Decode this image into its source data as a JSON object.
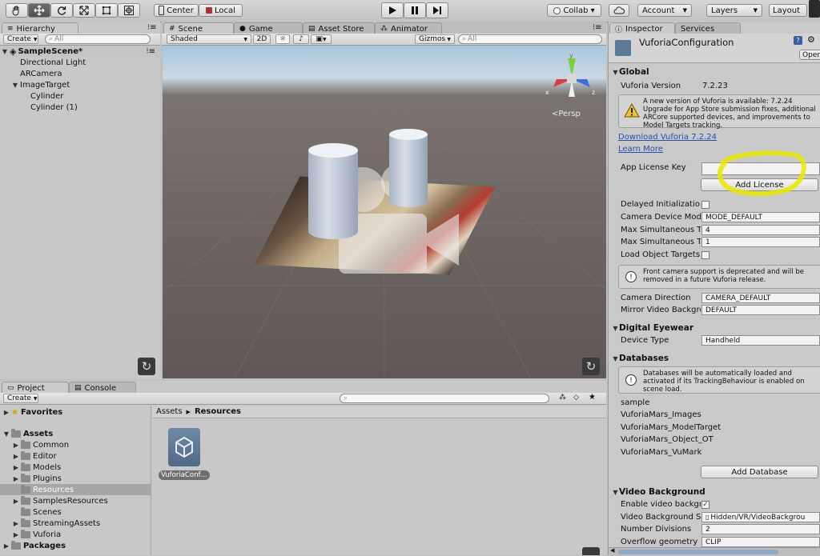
{
  "toolbar": {
    "center_label": "Center",
    "local_label": "Local",
    "collab_label": "Collab ▾",
    "account_label": "Account",
    "layers_label": "Layers",
    "layout_label": "Layout"
  },
  "hierarchy": {
    "tab": "Hierarchy",
    "create_label": "Create",
    "search_placeholder": "All",
    "scene_name": "SampleScene*",
    "items": [
      {
        "label": "Directional Light"
      },
      {
        "label": "ARCamera"
      },
      {
        "label": "ImageTarget"
      },
      {
        "label": "Cylinder"
      },
      {
        "label": "Cylinder (1)"
      }
    ]
  },
  "scene": {
    "tabs": [
      "Scene",
      "Game",
      "Asset Store",
      "Animator"
    ],
    "shading": "Shaded",
    "mode_2d": "2D",
    "gizmos_label": "Gizmos",
    "search_placeholder": "All",
    "persp_label": "<Persp",
    "axis_labels": {
      "x": "x",
      "z": "z",
      "y": "y"
    }
  },
  "project": {
    "tabs": [
      "Project",
      "Console"
    ],
    "create_label": "Create",
    "breadcrumb_root": "Assets",
    "breadcrumb_current": "Resources",
    "favorites_label": "Favorites",
    "assets_label": "Assets",
    "folders": [
      {
        "label": "Common"
      },
      {
        "label": "Editor"
      },
      {
        "label": "Models"
      },
      {
        "label": "Plugins"
      },
      {
        "label": "Resources"
      },
      {
        "label": "SamplesResources"
      },
      {
        "label": "Scenes"
      },
      {
        "label": "StreamingAssets"
      },
      {
        "label": "Vuforia"
      }
    ],
    "packages_label": "Packages",
    "asset_item_label": "VuforiaConf…"
  },
  "inspector": {
    "tabs": [
      "Inspector",
      "Services"
    ],
    "title": "VuforiaConfiguration",
    "open_label": "Oper",
    "global": {
      "header": "Global",
      "version_label": "Vuforia Version",
      "version_value": "7.2.23",
      "update_help": "A new version of Vuforia is available: 7.2.24 Upgrade for App Store submission fixes, additional ARCore supported devices, and improvements to Model Targets tracking.",
      "download_link": "Download Vuforia 7.2.24",
      "learn_more_link": "Learn More",
      "license_key_label": "App License Key",
      "add_license_label": "Add License",
      "delayed_init_label": "Delayed Initializatior",
      "camera_mode_label": "Camera Device Mod",
      "camera_mode_value": "MODE_DEFAULT",
      "max_tracked_label": "Max Simultaneous Tr",
      "max_tracked_value": "4",
      "max_tracked_2_label": "Max Simultaneous Tr",
      "max_tracked_2_value": "1",
      "load_object_label": "Load Object Targets",
      "front_camera_help": "Front camera support is deprecated and will be removed in a future Vuforia release.",
      "camera_direction_label": "Camera Direction",
      "camera_direction_value": "CAMERA_DEFAULT",
      "mirror_label": "Mirror Video Backgro",
      "mirror_value": "DEFAULT"
    },
    "digital_eyewear": {
      "header": "Digital Eyewear",
      "device_type_label": "Device Type",
      "device_type_value": "Handheld"
    },
    "databases": {
      "header": "Databases",
      "help": "Databases will be automatically loaded and activated if its TrackingBehaviour is enabled on scene load.",
      "items": [
        {
          "label": "sample"
        },
        {
          "label": "VuforiaMars_Images"
        },
        {
          "label": "VuforiaMars_ModelTarget"
        },
        {
          "label": "VuforiaMars_Object_OT"
        },
        {
          "label": "VuforiaMars_VuMark"
        }
      ],
      "add_label": "Add Database"
    },
    "video_background": {
      "header": "Video Background",
      "enable_label": "Enable video backgr",
      "shader_label": "Video Background S",
      "shader_value": "Hidden/VR/VideoBackgrou",
      "divisions_label": "Number Divisions",
      "divisions_value": "2",
      "overflow_label": "Overflow geometry",
      "overflow_value": "CLIP"
    }
  },
  "colors": {
    "highlight_yellow": "#e8e800",
    "link_blue": "#2a4fa8",
    "selection_gray": "#9a9a9a"
  }
}
